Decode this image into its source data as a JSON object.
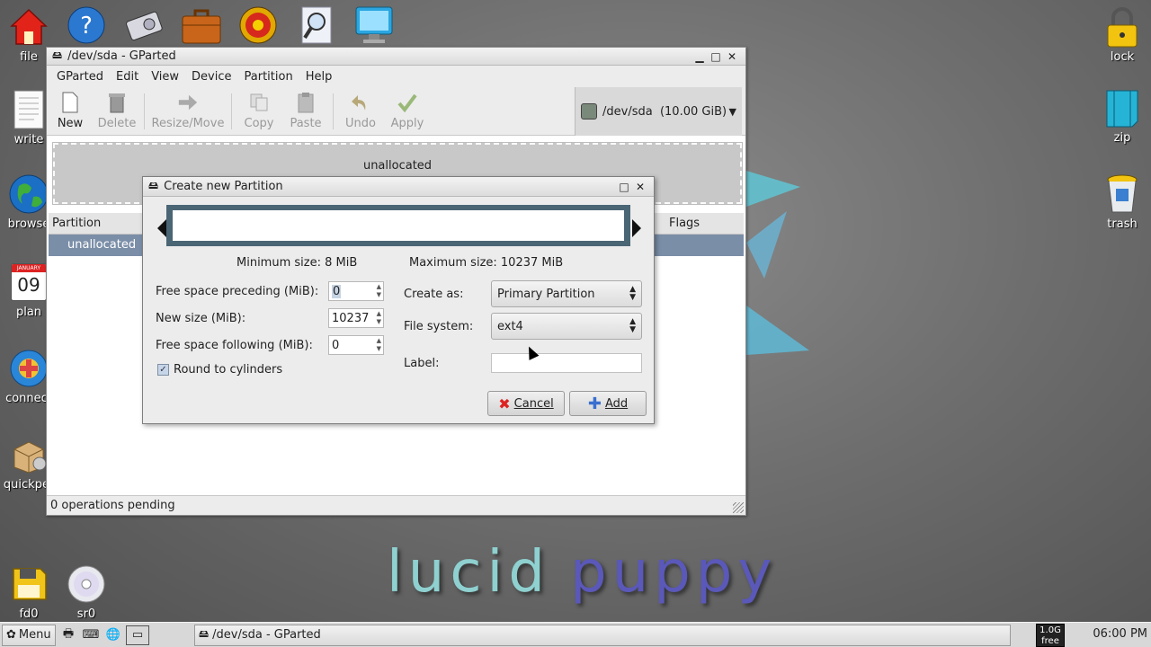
{
  "desktop": {
    "icons": [
      {
        "label": "file",
        "icon": "home-icon"
      },
      {
        "label": "write",
        "icon": "document-icon"
      },
      {
        "label": "browse",
        "icon": "globe-icon"
      },
      {
        "label": "plan",
        "icon": "calendar-icon"
      },
      {
        "label": "connect",
        "icon": "connect-icon"
      },
      {
        "label": "quickpet",
        "icon": "package-icon"
      },
      {
        "label": "fd0",
        "icon": "floppy-icon"
      },
      {
        "label": "sr0",
        "icon": "cd-icon"
      },
      {
        "label": "lock",
        "icon": "padlock-icon"
      },
      {
        "label": "zip",
        "icon": "archive-icon"
      },
      {
        "label": "trash",
        "icon": "trash-icon"
      }
    ],
    "calendar_month": "JANUARY",
    "calendar_day": "09",
    "brand_word1": "lucid",
    "brand_word2": "puppy"
  },
  "window": {
    "title": "/dev/sda - GParted",
    "menu": [
      "GParted",
      "Edit",
      "View",
      "Device",
      "Partition",
      "Help"
    ],
    "toolbar": {
      "new": "New",
      "delete": "Delete",
      "resize": "Resize/Move",
      "copy": "Copy",
      "paste": "Paste",
      "undo": "Undo",
      "apply": "Apply"
    },
    "device": "/dev/sda",
    "device_size": "(10.00 GiB)",
    "graph_label": "unallocated",
    "columns": {
      "partition": "Partition",
      "flags": "Flags"
    },
    "row_partition": "unallocated",
    "status": "0 operations pending"
  },
  "dialog": {
    "title": "Create new Partition",
    "min_size": "Minimum size: 8 MiB",
    "max_size": "Maximum size: 10237 MiB",
    "free_preceding_label": "Free space preceding (MiB):",
    "free_preceding_value": "0",
    "new_size_label": "New size (MiB):",
    "new_size_value": "10237",
    "free_following_label": "Free space following (MiB):",
    "free_following_value": "0",
    "round_label": "Round to cylinders",
    "round_checked": true,
    "create_as_label": "Create as:",
    "create_as_value": "Primary Partition",
    "filesystem_label": "File system:",
    "filesystem_value": "ext4",
    "label_label": "Label:",
    "label_value": "",
    "cancel": "Cancel",
    "add": "Add"
  },
  "taskbar": {
    "menu": "Menu",
    "task": "/dev/sda - GParted",
    "free_size": "1.0G",
    "free_label": "free",
    "clock": "06:00 PM"
  }
}
